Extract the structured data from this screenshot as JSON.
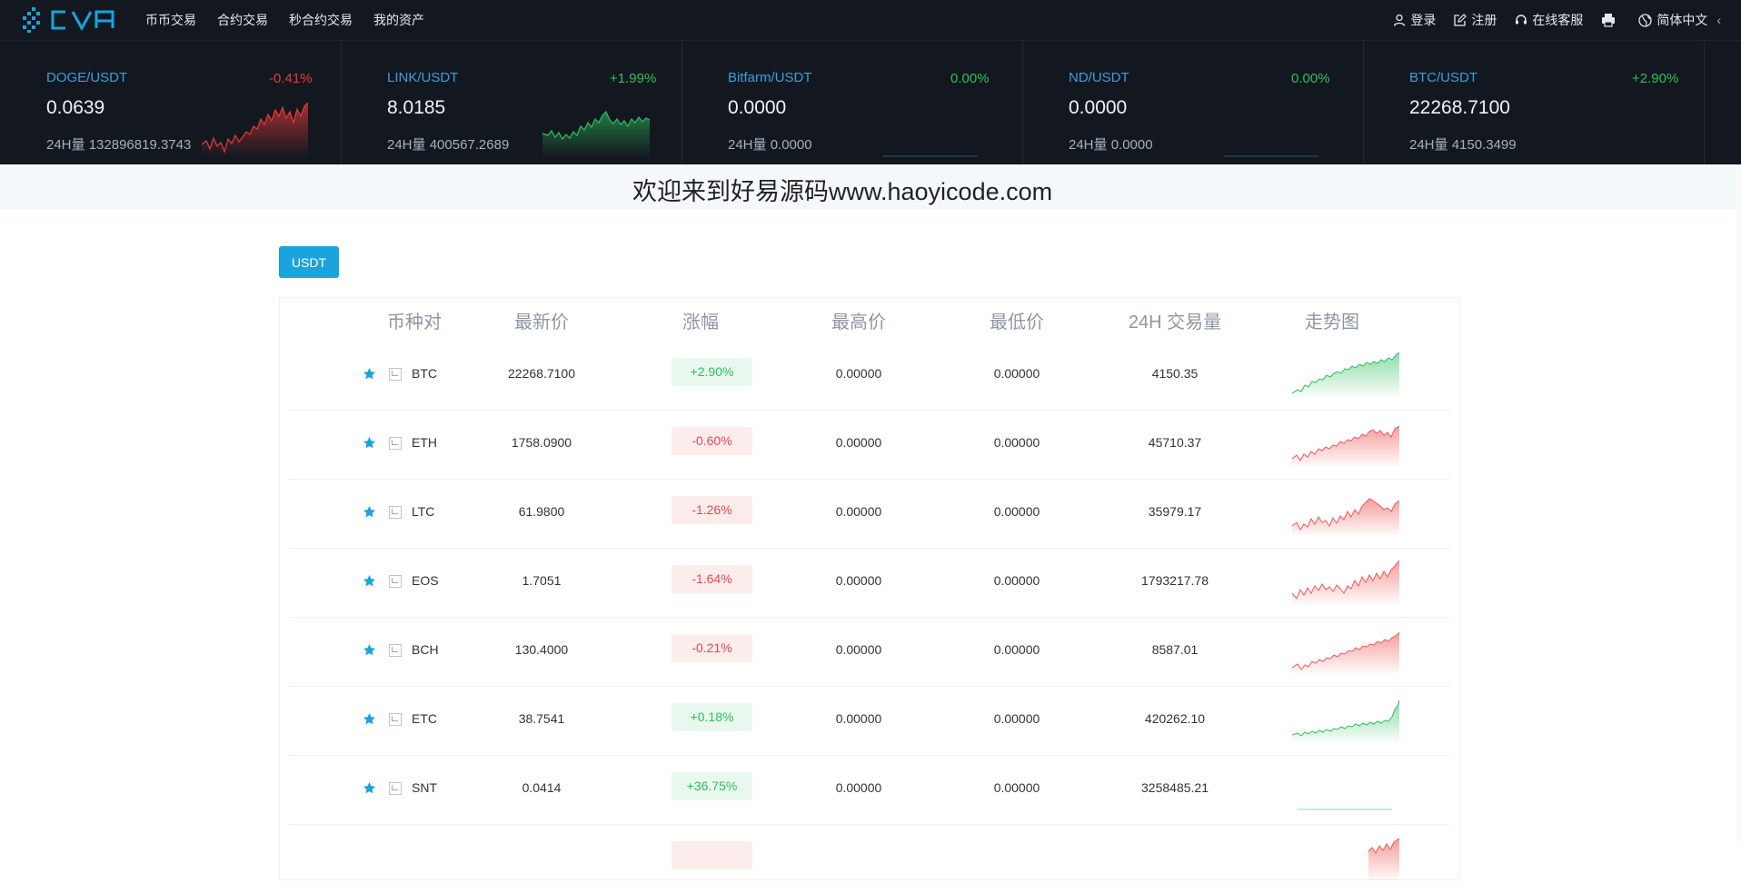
{
  "nav": {
    "logo_text": "CVA",
    "links": [
      "币币交易",
      "合约交易",
      "秒合约交易",
      "我的资产"
    ],
    "login": "登录",
    "register": "注册",
    "support": "在线客服",
    "language": "简体中文",
    "chevron": "‹",
    "colors": {
      "bg": "#131820",
      "accent": "#1aa3dd"
    }
  },
  "tickers": [
    {
      "pair": "DOGE/USDT",
      "change": "-0.41%",
      "direction": "down",
      "price": "0.0639",
      "vol_label": "24H量",
      "volume": "132896819.3743"
    },
    {
      "pair": "LINK/USDT",
      "change": "+1.99%",
      "direction": "up",
      "price": "8.0185",
      "vol_label": "24H量",
      "volume": "400567.2689"
    },
    {
      "pair": "Bitfarm/USDT",
      "change": "0.00%",
      "direction": "up",
      "price": "0.0000",
      "vol_label": "24H量",
      "volume": "0.0000"
    },
    {
      "pair": "ND/USDT",
      "change": "0.00%",
      "direction": "up",
      "price": "0.0000",
      "vol_label": "24H量",
      "volume": "0.0000"
    },
    {
      "pair": "BTC/USDT",
      "change": "+2.90%",
      "direction": "up",
      "price": "22268.7100",
      "vol_label": "24H量",
      "volume": "4150.3499"
    }
  ],
  "banner": {
    "text": "欢迎来到好易源码www.haoyicode.com"
  },
  "market": {
    "quote_tab": "USDT",
    "headers": [
      "币种对",
      "最新价",
      "涨幅",
      "最高价",
      "最低价",
      "24H 交易量",
      "走势图"
    ],
    "rows": [
      {
        "symbol": "BTC",
        "price": "22268.7100",
        "change": "+2.90%",
        "direction": "up",
        "high": "0.00000",
        "low": "0.00000",
        "volume": "4150.35"
      },
      {
        "symbol": "ETH",
        "price": "1758.0900",
        "change": "-0.60%",
        "direction": "down",
        "high": "0.00000",
        "low": "0.00000",
        "volume": "45710.37"
      },
      {
        "symbol": "LTC",
        "price": "61.9800",
        "change": "-1.26%",
        "direction": "down",
        "high": "0.00000",
        "low": "0.00000",
        "volume": "35979.17"
      },
      {
        "symbol": "EOS",
        "price": "1.7051",
        "change": "-1.64%",
        "direction": "down",
        "high": "0.00000",
        "low": "0.00000",
        "volume": "1793217.78"
      },
      {
        "symbol": "BCH",
        "price": "130.4000",
        "change": "-0.21%",
        "direction": "down",
        "high": "0.00000",
        "low": "0.00000",
        "volume": "8587.01"
      },
      {
        "symbol": "ETC",
        "price": "38.7541",
        "change": "+0.18%",
        "direction": "up",
        "high": "0.00000",
        "low": "0.00000",
        "volume": "420262.10"
      },
      {
        "symbol": "SNT",
        "price": "0.0414",
        "change": "+36.75%",
        "direction": "up",
        "high": "0.00000",
        "low": "0.00000",
        "volume": "3258485.21"
      }
    ]
  }
}
